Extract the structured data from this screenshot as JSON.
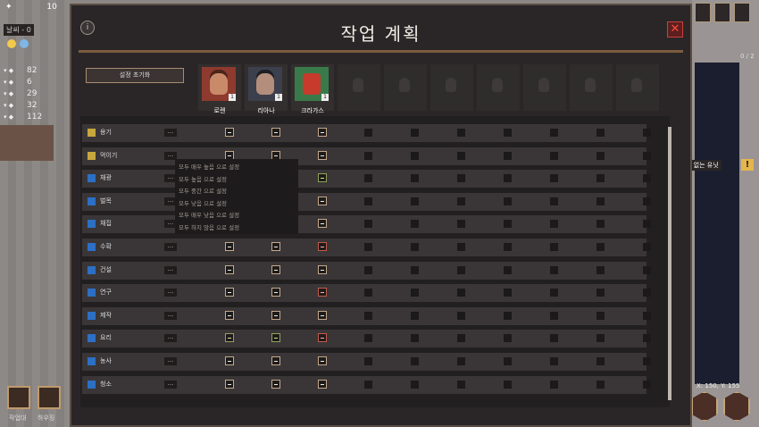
{
  "hud": {
    "top_number": "10",
    "days_text": "날씨 - 0",
    "resources": [
      {
        "icon": "wood-icon",
        "value": "82"
      },
      {
        "icon": "stone-icon",
        "value": "6"
      },
      {
        "icon": "plant-icon",
        "value": "29"
      },
      {
        "icon": "food-icon",
        "value": "32"
      },
      {
        "icon": "tool-icon",
        "value": "112"
      }
    ]
  },
  "modal": {
    "title": "작업 계획",
    "info_label": "i",
    "close_label": "✕",
    "reset_label": "설정 초기화"
  },
  "colonists": [
    {
      "name": "로렌",
      "badge": "1"
    },
    {
      "name": "리아나",
      "badge": "1"
    },
    {
      "name": "크라가스",
      "badge": "1"
    }
  ],
  "empty_slots": 7,
  "tasks": [
    {
      "label": "용기",
      "icon_color": "#c7a73d",
      "priorities": [
        "normal",
        "normal",
        "normal"
      ]
    },
    {
      "label": "먹이기",
      "icon_color": "#c7a73d",
      "priorities": [
        "normal",
        "normal",
        "normal"
      ]
    },
    {
      "label": "채광",
      "icon_color": "#2c6fc4",
      "priorities": [
        "normal",
        "normal",
        "green"
      ]
    },
    {
      "label": "벌목",
      "icon_color": "#2c6fc4",
      "priorities": [
        "normal",
        "normal",
        "normal"
      ]
    },
    {
      "label": "채집",
      "icon_color": "#2c6fc4",
      "priorities": [
        "normal",
        "normal",
        "normal"
      ]
    },
    {
      "label": "수확",
      "icon_color": "#2c6fc4",
      "priorities": [
        "normal",
        "normal",
        "red"
      ]
    },
    {
      "label": "건설",
      "icon_color": "#2c6fc4",
      "priorities": [
        "normal",
        "normal",
        "normal"
      ]
    },
    {
      "label": "연구",
      "icon_color": "#2c6fc4",
      "priorities": [
        "normal",
        "normal",
        "red"
      ]
    },
    {
      "label": "제작",
      "icon_color": "#2c6fc4",
      "priorities": [
        "normal",
        "normal",
        "normal"
      ]
    },
    {
      "label": "요리",
      "icon_color": "#2c6fc4",
      "priorities": [
        "green",
        "green",
        "red"
      ]
    },
    {
      "label": "농사",
      "icon_color": "#2c6fc4",
      "priorities": [
        "normal",
        "normal",
        "normal"
      ]
    },
    {
      "label": "청소",
      "icon_color": "#2c6fc4",
      "priorities": [
        "normal",
        "normal",
        "normal"
      ]
    }
  ],
  "dots_label": "...",
  "context_menu": [
    "모두 매우 높음 으로 설정",
    "모두 높음 으로 설정",
    "모두 중간 으로 설정",
    "모두 낮음 으로 설정",
    "모두 매우 낮음 으로 설정",
    "모두 하지 않음 으로 설정"
  ],
  "right_hud": {
    "page_counter": "0 / 2",
    "warning_text": "이 없는 유닛",
    "warning_icon": "!",
    "coords": "X: 150, Y: 155"
  },
  "bottom_left": [
    {
      "label": "작업대"
    },
    {
      "label": "하우징"
    }
  ]
}
